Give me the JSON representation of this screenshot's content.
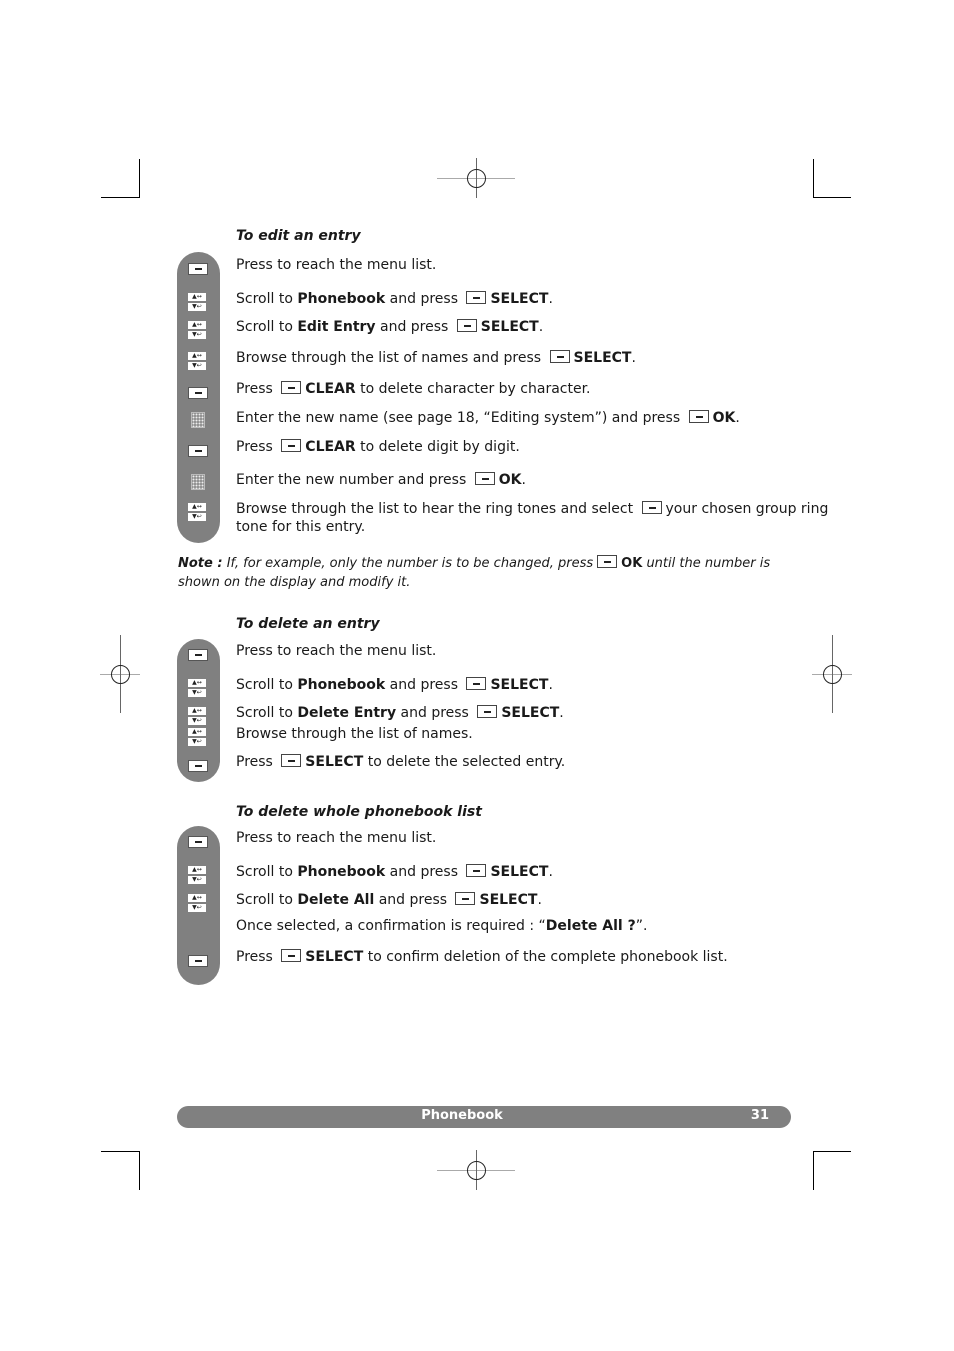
{
  "sections": [
    {
      "title": "To edit an entry",
      "steps": [
        {
          "icon": "menu-key",
          "parts": [
            {
              "t": "Press to reach the menu list."
            }
          ]
        },
        {
          "icon": "nav-key",
          "parts": [
            {
              "t": "Scroll to "
            },
            {
              "b": "Phonebook"
            },
            {
              "t": " and press "
            },
            {
              "k": true
            },
            {
              "b": "SELECT"
            },
            {
              "t": "."
            }
          ]
        },
        {
          "icon": "nav-key",
          "parts": [
            {
              "t": "Scroll to "
            },
            {
              "b": "Edit Entry"
            },
            {
              "t": " and press "
            },
            {
              "k": true
            },
            {
              "b": "SELECT"
            },
            {
              "t": "."
            }
          ]
        },
        {
          "icon": "nav-key",
          "parts": [
            {
              "t": "Browse through the list of names and press "
            },
            {
              "k": true
            },
            {
              "b": "SELECT"
            },
            {
              "t": "."
            }
          ]
        },
        {
          "icon": "menu-key",
          "parts": [
            {
              "t": "Press "
            },
            {
              "k": true
            },
            {
              "b": "CLEAR"
            },
            {
              "t": " to delete character by character."
            }
          ]
        },
        {
          "icon": "keypad",
          "parts": [
            {
              "t": "Enter the new name (see page 18, “Editing system”) and press "
            },
            {
              "k": true
            },
            {
              "b": "OK"
            },
            {
              "t": "."
            }
          ]
        },
        {
          "icon": "menu-key",
          "parts": [
            {
              "t": "Press "
            },
            {
              "k": true
            },
            {
              "b": "CLEAR"
            },
            {
              "t": " to delete digit by digit."
            }
          ]
        },
        {
          "icon": "keypad",
          "parts": [
            {
              "t": "Enter the new number and press "
            },
            {
              "k": true
            },
            {
              "b": "OK"
            },
            {
              "t": "."
            }
          ]
        },
        {
          "icon": "nav-key",
          "parts": [
            {
              "t": "Browse through the list to hear the ring tones and select "
            },
            {
              "k": true
            },
            {
              "t": "your chosen group ring"
            }
          ],
          "cont": "tone for this entry."
        }
      ]
    },
    {
      "title": "To delete an entry",
      "steps": [
        {
          "icon": "menu-key",
          "parts": [
            {
              "t": "Press to reach the menu list."
            }
          ]
        },
        {
          "icon": "nav-key",
          "parts": [
            {
              "t": "Scroll to "
            },
            {
              "b": "Phonebook"
            },
            {
              "t": " and press "
            },
            {
              "k": true
            },
            {
              "b": "SELECT"
            },
            {
              "t": "."
            }
          ]
        },
        {
          "icon": "nav-key",
          "parts": [
            {
              "t": "Scroll to "
            },
            {
              "b": "Delete Entry"
            },
            {
              "t": " and press "
            },
            {
              "k": true
            },
            {
              "b": "SELECT"
            },
            {
              "t": "."
            }
          ]
        },
        {
          "icon": "nav-key",
          "parts": [
            {
              "t": "Browse through the list of names."
            }
          ]
        },
        {
          "icon": "menu-key",
          "parts": [
            {
              "t": "Press "
            },
            {
              "k": true
            },
            {
              "b": "SELECT"
            },
            {
              "t": " to delete the selected entry."
            }
          ]
        }
      ]
    },
    {
      "title": "To delete whole phonebook list",
      "steps": [
        {
          "icon": "menu-key",
          "parts": [
            {
              "t": "Press to reach the menu list."
            }
          ]
        },
        {
          "icon": "nav-key",
          "parts": [
            {
              "t": "Scroll to "
            },
            {
              "b": "Phonebook"
            },
            {
              "t": " and press "
            },
            {
              "k": true
            },
            {
              "b": "SELECT"
            },
            {
              "t": "."
            }
          ]
        },
        {
          "icon": "nav-key",
          "parts": [
            {
              "t": "Scroll to "
            },
            {
              "b": "Delete All"
            },
            {
              "t": " and press "
            },
            {
              "k": true
            },
            {
              "b": "SELECT"
            },
            {
              "t": "."
            }
          ]
        },
        {
          "icon": null,
          "parts": [
            {
              "t": "Once selected, a confirmation is required : “"
            },
            {
              "b": "Delete All ?"
            },
            {
              "t": "”."
            }
          ]
        },
        {
          "icon": "menu-key",
          "parts": [
            {
              "t": "Press "
            },
            {
              "k": true
            },
            {
              "b": "SELECT"
            },
            {
              "t": " to confirm deletion of the complete phonebook list."
            }
          ]
        }
      ]
    }
  ],
  "note": {
    "label": "Note :",
    "text_before": "If, for example, only the number is to be changed, press",
    "key_label": "OK",
    "text_after": "until the number is shown on the display and modify it."
  },
  "footer": {
    "section": "Phonebook",
    "page": "31"
  }
}
